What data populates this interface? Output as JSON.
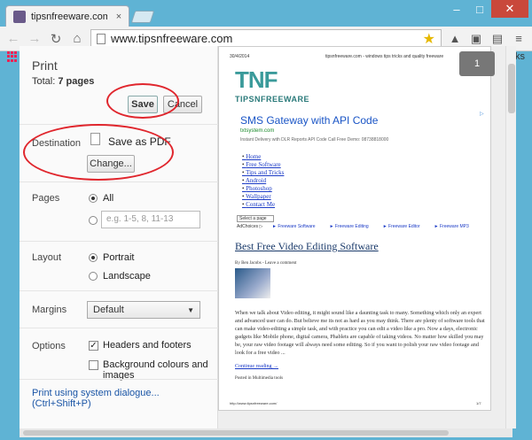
{
  "browser": {
    "tab_title": "tipsnfreeware.com - windo",
    "tab_close": "×",
    "url": "www.tipsnfreeware.com",
    "win_min": "–",
    "win_max": "□",
    "win_close": "✕",
    "bookmarks_tail": "rks"
  },
  "print_panel": {
    "title": "Print",
    "total_label": "Total:",
    "total_value": "7 pages",
    "save_label": "Save",
    "cancel_label": "Cancel",
    "destination_label": "Destination",
    "destination_value": "Save as PDF",
    "change_label": "Change...",
    "pages_label": "Pages",
    "pages_all": "All",
    "pages_placeholder": "e.g. 1-5, 8, 11-13",
    "layout_label": "Layout",
    "layout_portrait": "Portrait",
    "layout_landscape": "Landscape",
    "margins_label": "Margins",
    "margins_value": "Default",
    "options_label": "Options",
    "opt_headers": "Headers and footers",
    "opt_background": "Background colours and images",
    "system_dialog": "Print using system dialogue... (Ctrl+Shift+P)"
  },
  "preview": {
    "page_indicator": "1",
    "date": "30/4/2014",
    "header_center": "tipsnfreeware.com - windows tips tricks and quality freeware",
    "logo": "TNF",
    "logo_sub": "TIPSNFREEWARE",
    "ad_title": "SMS Gateway with API Code",
    "ad_url": "txtsystem.com",
    "ad_desc": "Instant Delivery with DLR Reports API Code Call Free Demo: 08738818000",
    "menu": [
      "Home",
      "Free Software",
      "Tips and Tricks",
      "Android",
      "Photoshop",
      "Wallpaper",
      "Contact Me"
    ],
    "select_page": "Select a page",
    "adchoices": "AdChoices ▷",
    "ad_links": [
      "► Freeware Software",
      "► Freeware Editing",
      "► Freeware Editor",
      "► Freeware MP3"
    ],
    "post_title": "Best Free Video Editing Software",
    "byline": "By Ben Jacobs - Leave a comment",
    "body": "When we talk about Video editing, it might sound like a daunting task to many. Something which only an expert and advanced user can do. But believe me its not as hard as you may think. There are plenty of software tools that can make video-editing a simple task, and with practice you can edit a video like a pro. Now a days, electronic gadgets like Mobile phone, digital camera, Phablets are capable of taking videos. No matter how skilled you may be, your raw video footage will always need some editing. So if you want to polish your raw video footage and look for a free video ...",
    "continue": "Continue reading →",
    "posted": "Posted in Multimedia tools",
    "footer_url": "http://www.tipsnfreeware.com/",
    "footer_page": "1/7"
  },
  "colors": {
    "annotation": "#e0262d",
    "frame": "#5fb3d4",
    "link": "#1a55a6"
  }
}
